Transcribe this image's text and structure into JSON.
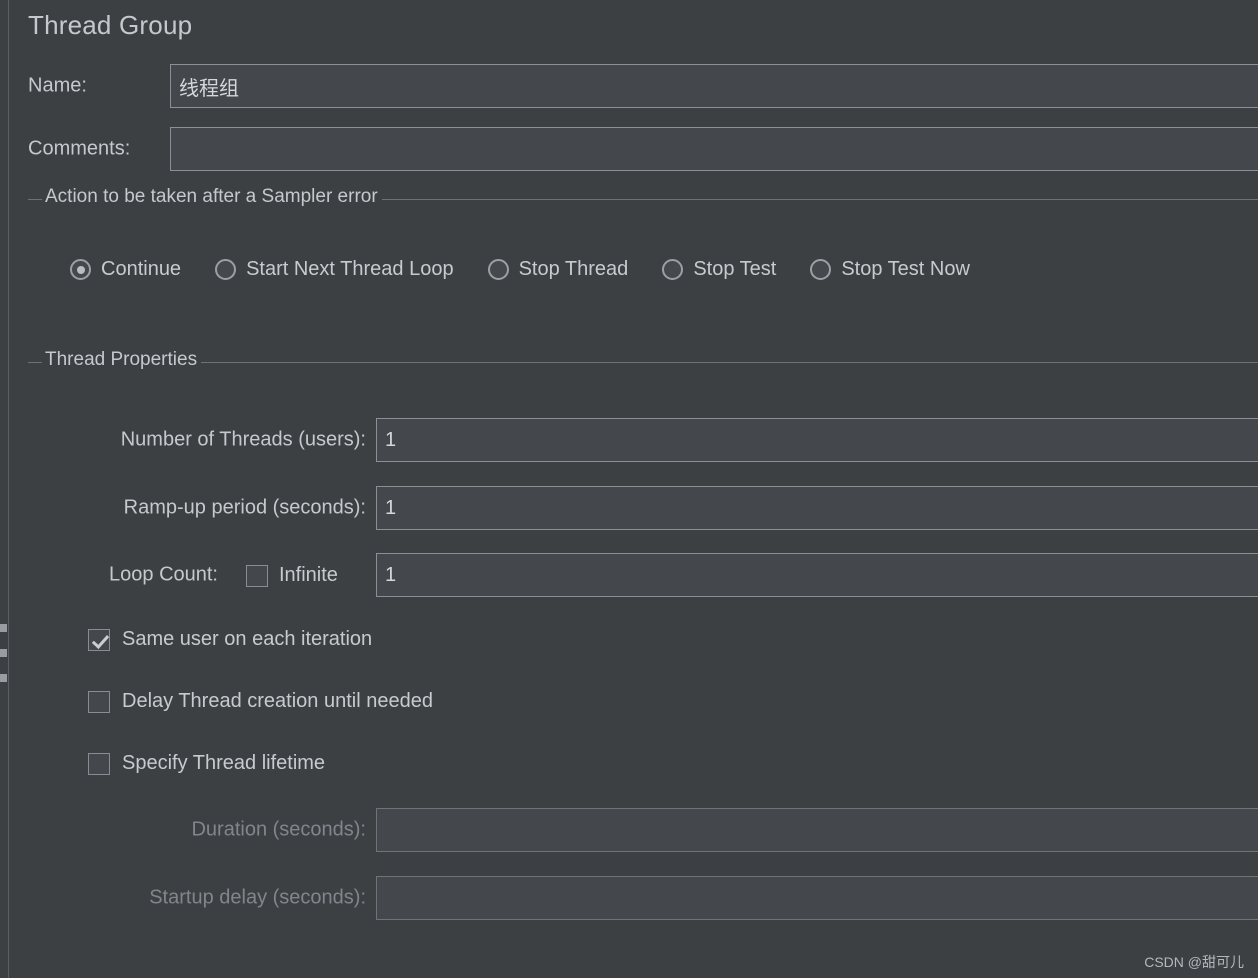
{
  "panel": {
    "title": "Thread Group"
  },
  "name_row": {
    "label": "Name:",
    "value": "线程组",
    "placeholder": ""
  },
  "comments_row": {
    "label": "Comments:",
    "value": "",
    "placeholder": ""
  },
  "sampler_error_group": {
    "title": "Action to be taken after a Sampler error",
    "selected": "Continue",
    "options": [
      {
        "label": "Continue",
        "checked": true
      },
      {
        "label": "Start Next Thread Loop",
        "checked": false
      },
      {
        "label": "Stop Thread",
        "checked": false
      },
      {
        "label": "Stop Test",
        "checked": false
      },
      {
        "label": "Stop Test Now",
        "checked": false
      }
    ]
  },
  "thread_properties": {
    "title": "Thread Properties",
    "num_threads": {
      "label": "Number of Threads (users):",
      "value": "1"
    },
    "ramp_up": {
      "label": "Ramp-up period (seconds):",
      "value": "1"
    },
    "loop_count": {
      "label": "Loop Count:",
      "infinite_label": "Infinite",
      "infinite_checked": false,
      "value": "1"
    },
    "same_user": {
      "label": "Same user on each iteration",
      "checked": true
    },
    "delay_creation": {
      "label": "Delay Thread creation until needed",
      "checked": false
    },
    "specify_lifetime": {
      "label": "Specify Thread lifetime",
      "checked": false
    },
    "duration": {
      "label": "Duration (seconds):",
      "value": "",
      "enabled": false
    },
    "startup_delay": {
      "label": "Startup delay (seconds):",
      "value": "",
      "enabled": false
    }
  },
  "watermark": {
    "text": "CSDN @甜可儿"
  },
  "colors": {
    "background": "#3c4043",
    "field_background": "#44484c",
    "field_border": "#8b9094",
    "text": "#c5c9cd",
    "text_disabled": "#80868b",
    "group_line": "#6d7276"
  }
}
